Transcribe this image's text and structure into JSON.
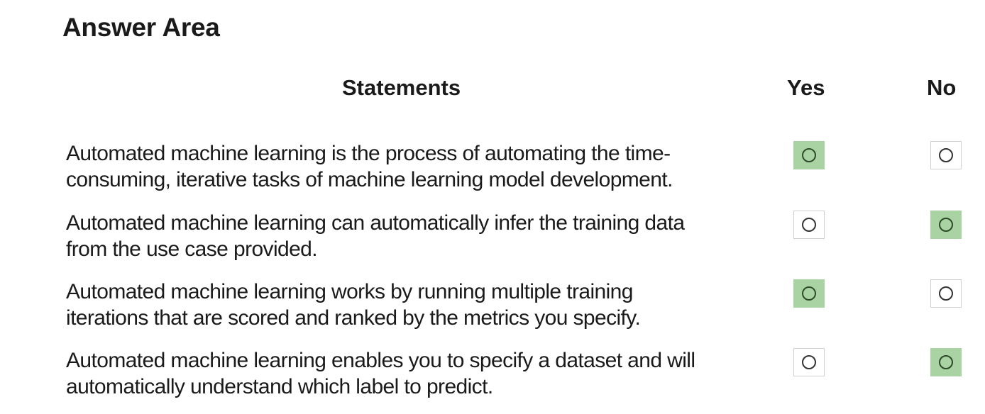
{
  "title": "Answer Area",
  "headers": {
    "statements": "Statements",
    "yes": "Yes",
    "no": "No"
  },
  "colors": {
    "selected_fill": "#a9d3a3"
  },
  "rows": [
    {
      "line1": "Automated machine learning is the process of automating the time-",
      "line2": "consuming, iterative tasks of machine learning model development.",
      "yes_selected": true,
      "no_selected": false
    },
    {
      "line1": "Automated machine learning can automatically infer the training data",
      "line2": "from the use case provided.",
      "yes_selected": false,
      "no_selected": true
    },
    {
      "line1": "Automated machine learning works by running multiple training",
      "line2": "iterations that are scored and ranked by the metrics you specify.",
      "yes_selected": true,
      "no_selected": false
    },
    {
      "line1": "Automated machine learning enables you to specify a dataset and will",
      "line2": "automatically understand which label to predict.",
      "yes_selected": false,
      "no_selected": true
    }
  ]
}
